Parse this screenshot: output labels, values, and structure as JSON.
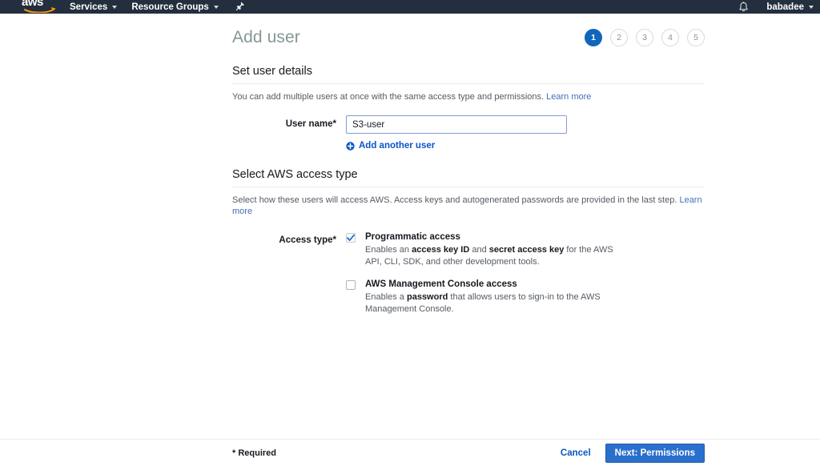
{
  "navbar": {
    "logo_text": "aws",
    "logo_alt": "aws-logo",
    "items": [
      {
        "label": "Services"
      },
      {
        "label": "Resource Groups"
      }
    ],
    "pin_icon": "pin-icon",
    "bell_icon": "bell-icon",
    "user": "babadee"
  },
  "header": {
    "title": "Add user",
    "steps": [
      {
        "label": "1",
        "active": true
      },
      {
        "label": "2",
        "active": false
      },
      {
        "label": "3",
        "active": false
      },
      {
        "label": "4",
        "active": false
      },
      {
        "label": "5",
        "active": false
      }
    ]
  },
  "user_details": {
    "section_title": "Set user details",
    "description": "You can add multiple users at once with the same access type and permissions.",
    "learn_more": "Learn more",
    "username_label": "User name*",
    "username_value": "S3-user",
    "username_placeholder": "",
    "add_another_label": "Add another user"
  },
  "access_type": {
    "section_title": "Select AWS access type",
    "description": "Select how these users will access AWS. Access keys and autogenerated passwords are provided in the last step.",
    "learn_more": "Learn more",
    "label": "Access type*",
    "options": [
      {
        "title": "Programmatic access",
        "checked": true,
        "desc_part1": "Enables an ",
        "desc_bold1": "access key ID",
        "desc_part2": " and ",
        "desc_bold2": "secret access key",
        "desc_part3": " for the AWS API, CLI, SDK, and other development tools."
      },
      {
        "title": "AWS Management Console access",
        "checked": false,
        "desc_part1": "Enables a ",
        "desc_bold1": "password",
        "desc_part2": " that allows users to sign-in to the AWS Management Console.",
        "desc_bold2": "",
        "desc_part3": ""
      }
    ]
  },
  "footer": {
    "required_note": "* Required",
    "cancel_label": "Cancel",
    "next_label": "Next: Permissions"
  },
  "colors": {
    "nav_bg": "#232f3e",
    "accent_blue": "#1166bb",
    "link_blue": "#0a55c4",
    "button_blue": "#2a6fcc",
    "logo_orange": "#ff9900"
  }
}
